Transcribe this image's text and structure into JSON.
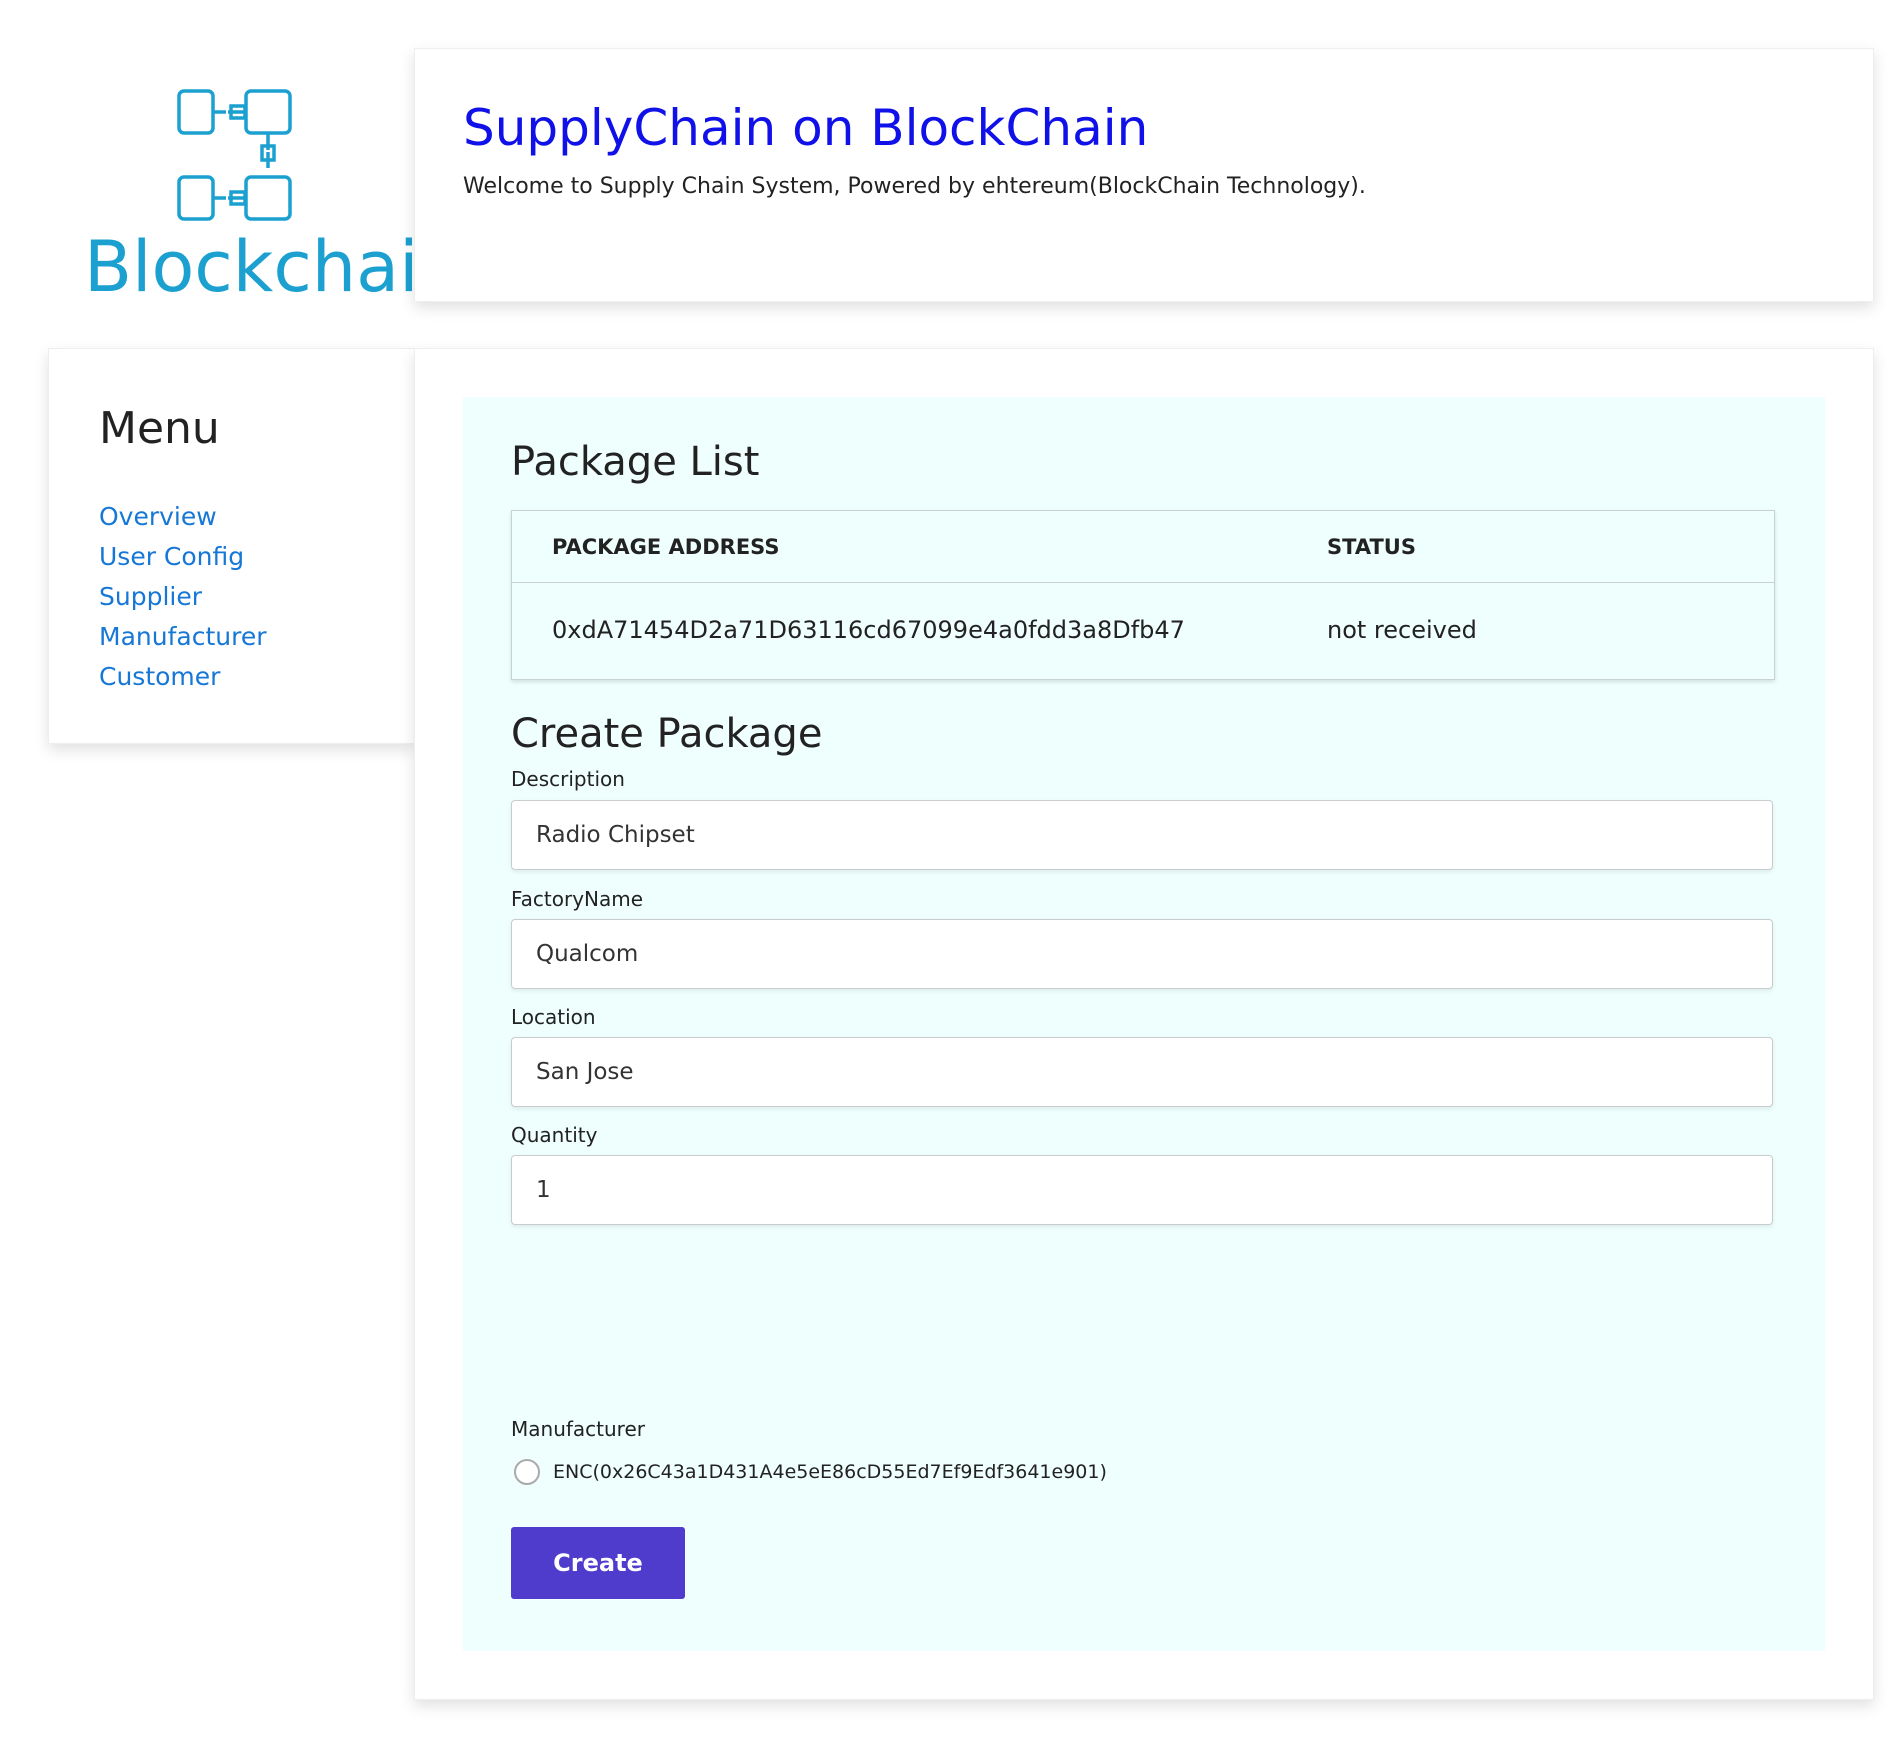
{
  "logo": {
    "text": "Blockchain"
  },
  "header": {
    "title": "SupplyChain on BlockChain",
    "subtitle": "Welcome to Supply Chain System, Powered by ehtereum(BlockChain Technology)."
  },
  "menu": {
    "title": "Menu",
    "items": [
      {
        "label": "Overview"
      },
      {
        "label": "User Config"
      },
      {
        "label": "Supplier"
      },
      {
        "label": "Manufacturer"
      },
      {
        "label": "Customer"
      }
    ]
  },
  "package_list": {
    "title": "Package List",
    "columns": [
      "PACKAGE ADDRESS",
      "STATUS"
    ],
    "rows": [
      {
        "address": "0xdA71454D2a71D63116cd67099e4a0fdd3a8Dfb47",
        "status": "not received"
      }
    ]
  },
  "create_package": {
    "title": "Create Package",
    "fields": {
      "description": {
        "label": "Description",
        "value": "Radio Chipset"
      },
      "factory_name": {
        "label": "FactoryName",
        "value": "Qualcom"
      },
      "location": {
        "label": "Location",
        "value": "San Jose"
      },
      "quantity": {
        "label": "Quantity",
        "value": "1"
      }
    },
    "manufacturer": {
      "label": "Manufacturer",
      "options": [
        {
          "label": "ENC(0x26C43a1D431A4e5eE86cD55Ed7Ef9Edf3641e901)",
          "selected": false
        }
      ]
    },
    "submit_label": "Create"
  },
  "colors": {
    "title": "#1010e8",
    "link": "#1677d6",
    "logo": "#1ba0d0",
    "panel_bg": "#effffd",
    "button": "#4f3ccc"
  }
}
